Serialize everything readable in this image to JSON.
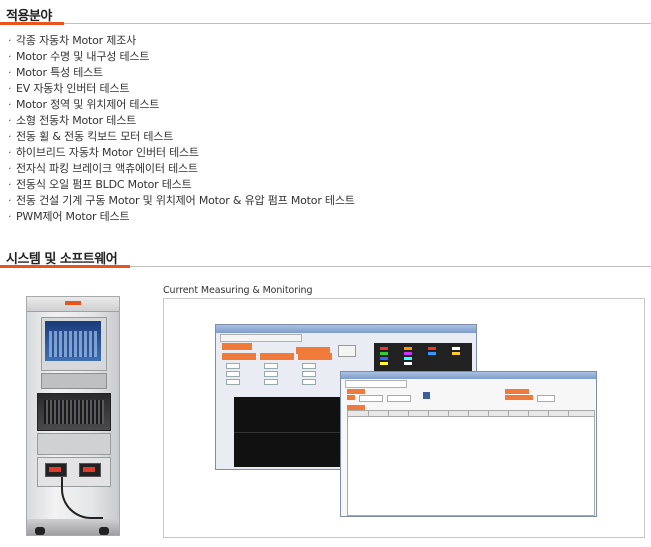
{
  "section1": {
    "title": "적용분야",
    "items": [
      "각종 자동차 Motor 제조사",
      "Motor 수명 및 내구성 테스트",
      "Motor 특성 테스트",
      "EV 자동차 인버터 테스트",
      "Motor 정역 및 위치제어 테스트",
      "소형 전동차 Motor 테스트",
      "전동 휠 & 전동 킥보드 모터 테스트",
      "하이브리드 자동차 Motor 인버터 테스트",
      "전자식 파킹 브레이크 액츄에이터 테스트",
      "전동식 오일 펌프 BLDC Motor 테스트",
      "전동 건설 기계 구동 Motor 및 위치제어 Motor & 유압 펌프 Motor 테스트",
      "PWM제어 Motor 테스트"
    ],
    "bullet": "·"
  },
  "section2": {
    "title": "시스템 및 소프트웨어",
    "caption": "Current Measuring & Monitoring"
  },
  "colors": {
    "accent": "#e8541e",
    "rule": "#bfbfbf",
    "panel_orange": "#f07a3a"
  }
}
